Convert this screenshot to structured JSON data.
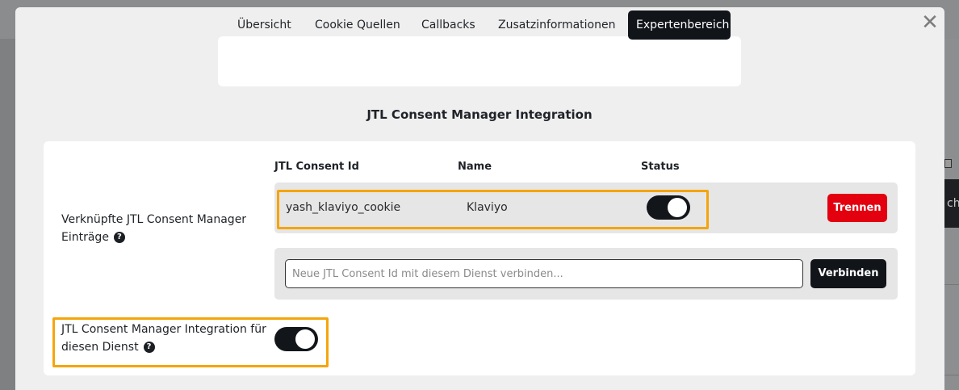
{
  "modal": {
    "close_glyph": "✕",
    "tabs": [
      {
        "label": "Übersicht",
        "active": false
      },
      {
        "label": "Cookie Quellen",
        "active": false
      },
      {
        "label": "Callbacks",
        "active": false
      },
      {
        "label": "Zusatzinformationen",
        "active": false
      },
      {
        "label": "Expertenbereich",
        "active": true
      }
    ],
    "section_title": "JTL Consent Manager Integration",
    "table": {
      "headers": {
        "consent_id": "JTL Consent Id",
        "name": "Name",
        "status": "Status"
      },
      "rows": [
        {
          "consent_id": "yash_klaviyo_cookie",
          "name": "Klaviyo",
          "status_on": true
        }
      ],
      "disconnect_label": "Trennen"
    },
    "linked_label_line1": "Verknüpfte JTL Consent Manager",
    "linked_label_line2": "Einträge",
    "help_glyph": "?",
    "connect": {
      "placeholder": "Neue JTL Consent Id mit diesem Dienst verbinden...",
      "value": "",
      "button_label": "Verbinden"
    },
    "integration_label_line1": "JTL Consent Manager Integration für",
    "integration_label_line2": "diesen Dienst",
    "integration_enabled": true
  },
  "background": {
    "partial_button_text": "che"
  },
  "colors": {
    "accent_dark": "#11151a",
    "danger": "#e3000f",
    "highlight": "#f5a50b"
  }
}
